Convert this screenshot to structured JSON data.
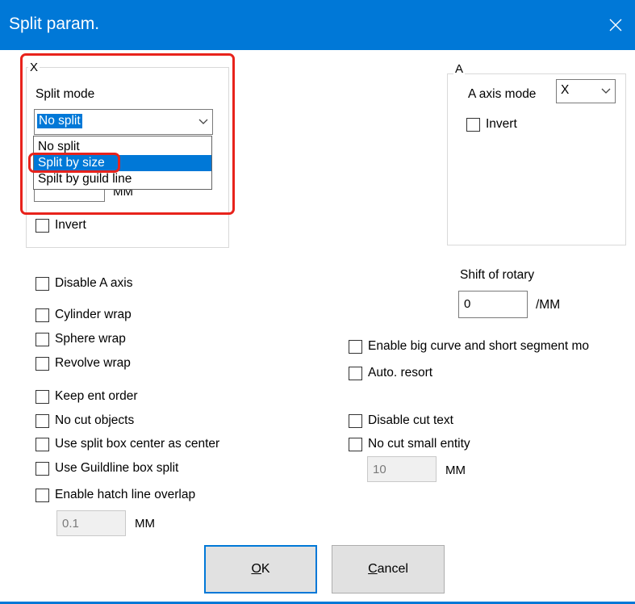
{
  "window": {
    "title": "Split param.",
    "close_icon": "close-icon"
  },
  "x_group": {
    "label": "X",
    "split_mode_label": "Split mode",
    "split_mode_value": "No split",
    "dropdown_options": [
      "No split",
      "Split by size",
      "Spilt by guild line"
    ],
    "selected_option_index": 1,
    "partial_unit_text": "MM",
    "invert_label": "Invert"
  },
  "a_group": {
    "label": "A",
    "axis_mode_label": "A axis mode",
    "axis_mode_value": "X",
    "invert_label": "Invert"
  },
  "left_options": {
    "disable_a_axis": "Disable A axis",
    "cylinder_wrap": "Cylinder wrap",
    "sphere_wrap": "Sphere wrap",
    "revolve_wrap": "Revolve wrap",
    "keep_ent_order": "Keep ent order",
    "no_cut_objects": "No cut objects",
    "use_split_box_center": "Use split box center as center",
    "use_guildline_box_split": "Use Guildline box split",
    "enable_hatch_line_overlap": "Enable hatch line overlap",
    "hatch_overlap_value": "0.1",
    "hatch_overlap_unit": "MM"
  },
  "right_options": {
    "shift_of_rotary_label": "Shift of rotary",
    "shift_of_rotary_value": "0",
    "shift_of_rotary_unit": "/MM",
    "enable_big_curve": "Enable big curve and short segment mo",
    "auto_resort": "Auto. resort",
    "disable_cut_text": "Disable cut text",
    "no_cut_small_entity": "No cut small entity",
    "small_entity_value": "10",
    "small_entity_unit": "MM"
  },
  "buttons": {
    "ok_prefix": "O",
    "ok_rest": "K",
    "cancel_prefix": "C",
    "cancel_rest": "ancel"
  },
  "colors": {
    "accent": "#0078d7",
    "highlight": "#e8231c"
  }
}
